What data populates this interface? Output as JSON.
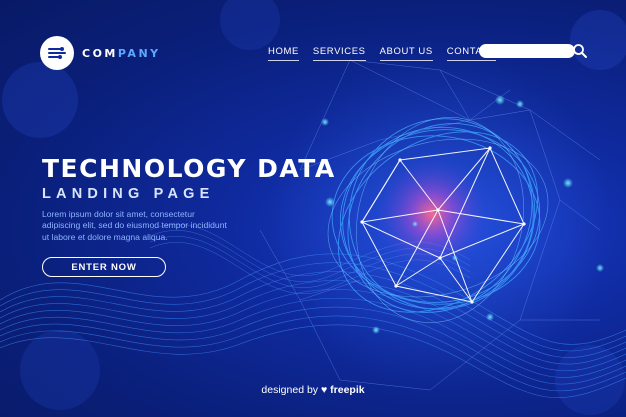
{
  "logo": {
    "text_a": "COM",
    "text_b": "PANY"
  },
  "nav": {
    "items": [
      {
        "label": "HOME"
      },
      {
        "label": "SERVICES"
      },
      {
        "label": "ABOUT US"
      },
      {
        "label": "CONTACT"
      }
    ]
  },
  "search": {
    "placeholder": "",
    "icon": "search-icon"
  },
  "hero": {
    "title": "TECHNOLOGY DATA",
    "subtitle": "LANDING PAGE",
    "body": "Lorem ipsum dolor sit amet, consectetur adipiscing elit, sed do eiusmod tempor incididunt ut labore et dolore magna aliqua.",
    "cta_label": "ENTER NOW"
  },
  "footer": {
    "prefix": "designed by",
    "brand": "freepik"
  },
  "colors": {
    "background": "#0a1f7a",
    "accent": "#5ea8ff",
    "glow": "#ff5f8a"
  }
}
